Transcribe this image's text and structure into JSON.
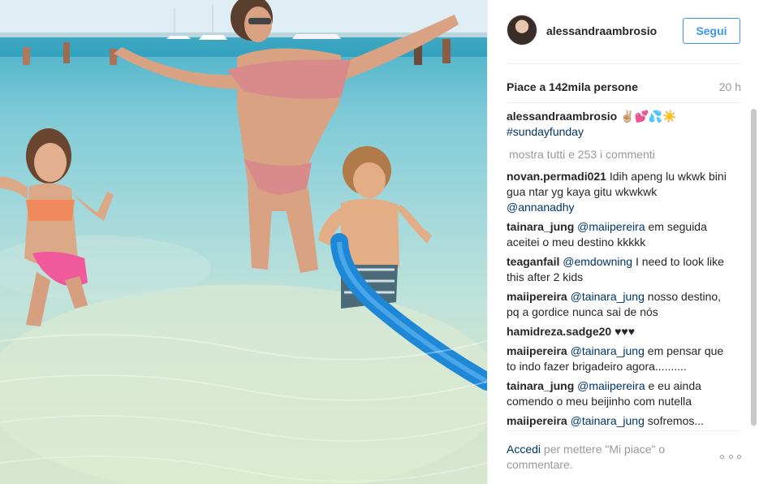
{
  "header": {
    "username": "alessandraambrosio",
    "follow_label": "Segui"
  },
  "stats": {
    "likes": "Piace a 142mila persone",
    "time_ago": "20 h"
  },
  "caption": {
    "username": "alessandraambrosio",
    "text": "✌🏼💕💦☀️",
    "hashtag": "#sundayfunday"
  },
  "load_more": "mostra tutti e 253 i commenti",
  "comments": [
    {
      "user": "novan.permadi021",
      "text": "Idih apeng lu wkwk bini gua ntar yg kaya gitu wkwkwk ",
      "mention": "@annanadhy",
      "after": ""
    },
    {
      "user": "tainara_jung",
      "text": "",
      "mention": "@maiipereira",
      "after": " em seguida aceitei o meu destino kkkkk"
    },
    {
      "user": "teaganfail",
      "text": "",
      "mention": "@emdowning",
      "after": " I need to look like this after 2 kids"
    },
    {
      "user": "maiipereira",
      "text": "",
      "mention": "@tainara_jung",
      "after": " nosso destino, pq a gordice nunca sai de nós"
    },
    {
      "user": "hamidreza.sadge20",
      "text": "♥♥♥",
      "mention": "",
      "after": ""
    },
    {
      "user": "maiipereira",
      "text": "",
      "mention": "@tainara_jung",
      "after": " em pensar que to indo fazer brigadeiro agora.........."
    },
    {
      "user": "tainara_jung",
      "text": "",
      "mention": "@maiipereira",
      "after": " e eu ainda comendo o meu beijinho com nutella"
    },
    {
      "user": "maiipereira",
      "text": "",
      "mention": "@tainara_jung",
      "after": " sofremos..."
    }
  ],
  "footer": {
    "login_link": "Accedi",
    "login_text": " per mettere \"Mi piace\" o commentare."
  },
  "icons": {
    "more": "more-options-icon"
  }
}
